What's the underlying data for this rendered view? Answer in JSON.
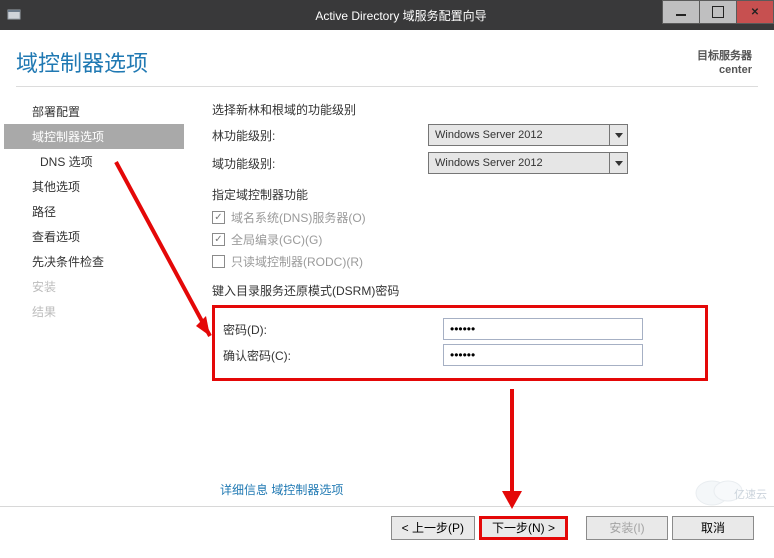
{
  "titlebar": {
    "title": "Active Directory 域服务配置向导"
  },
  "header": {
    "page_title": "域控制器选项",
    "target_label": "目标服务器",
    "target_value": "center"
  },
  "sidebar": {
    "items": [
      {
        "label": "部署配置"
      },
      {
        "label": "域控制器选项"
      },
      {
        "label": "DNS 选项"
      },
      {
        "label": "其他选项"
      },
      {
        "label": "路径"
      },
      {
        "label": "查看选项"
      },
      {
        "label": "先决条件检查"
      },
      {
        "label": "安装"
      },
      {
        "label": "结果"
      }
    ]
  },
  "content": {
    "func_level_heading": "选择新林和根域的功能级别",
    "forest_label": "林功能级别:",
    "forest_value": "Windows Server 2012",
    "domain_label": "域功能级别:",
    "domain_value": "Windows Server 2012",
    "dc_cap_heading": "指定域控制器功能",
    "ck_dns": "域名系统(DNS)服务器(O)",
    "ck_gc": "全局编录(GC)(G)",
    "ck_rodc": "只读域控制器(RODC)(R)",
    "dsrm_heading": "键入目录服务还原模式(DSRM)密码",
    "pw_label": "密码(D):",
    "pw_confirm_label": "确认密码(C):",
    "pw_value": "••••••",
    "pw_confirm_value": "••••••",
    "more_info": "详细信息 域控制器选项"
  },
  "buttons": {
    "prev": "< 上一步(P)",
    "next": "下一步(N) >",
    "install": "安装(I)",
    "cancel": "取消"
  }
}
